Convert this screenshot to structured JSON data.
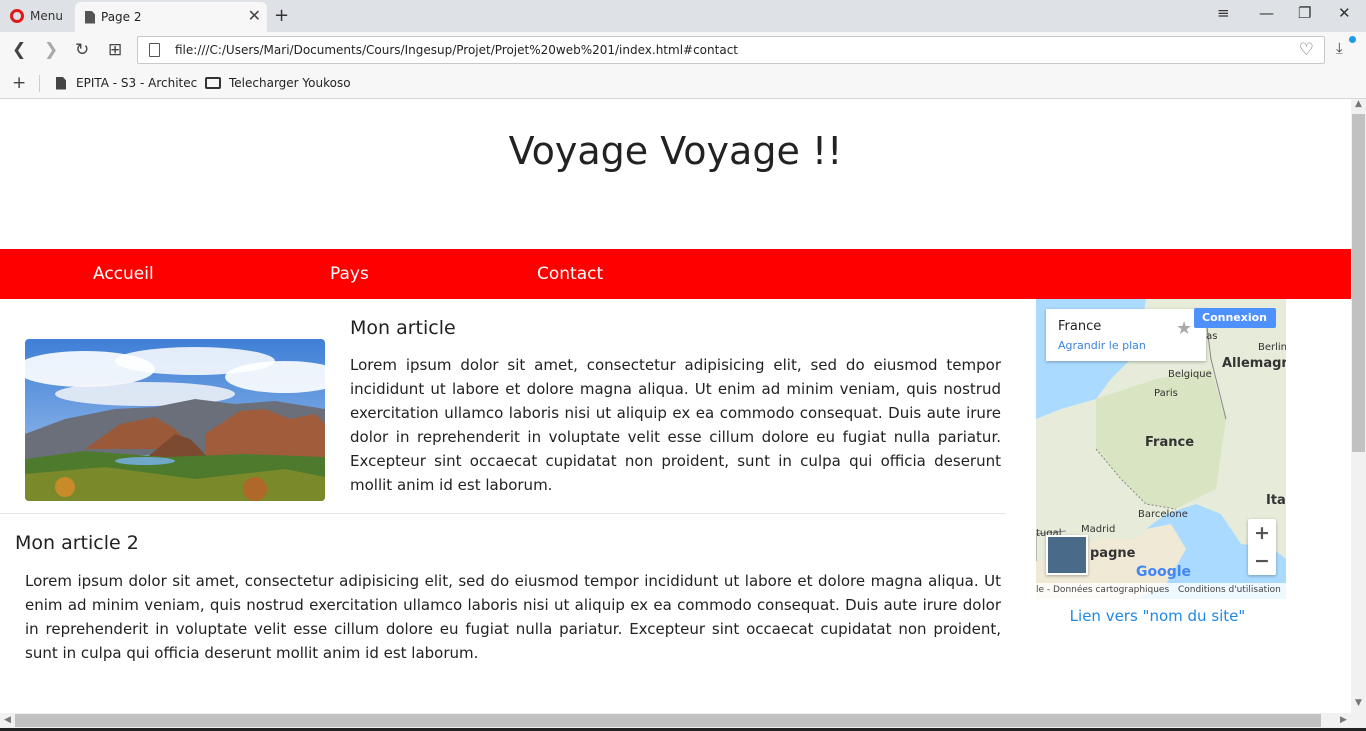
{
  "browser": {
    "menu_label": "Menu",
    "tab_title": "Page 2",
    "url": "file:///C:/Users/Mari/Documents/Cours/Ingesup/Projet/Projet%20web%201/index.html#contact",
    "bookmarks": [
      "EPITA - S3 - Architec",
      "Telecharger Youkoso"
    ]
  },
  "site": {
    "title": "Voyage Voyage !!",
    "nav": [
      "Accueil",
      "Pays",
      "Contact"
    ]
  },
  "article1": {
    "title": "Mon article",
    "text": "Lorem ipsum dolor sit amet, consectetur adipisicing elit, sed do eiusmod tempor incididunt ut labore et dolore magna aliqua. Ut enim ad minim veniam, quis nostrud exercitation ullamco laboris nisi ut aliquip ex ea commodo consequat. Duis aute irure dolor in reprehenderit in voluptate velit esse cillum dolore eu fugiat nulla pariatur. Excepteur sint occaecat cupidatat non proident, sunt in culpa qui officia deserunt mollit anim id est laborum."
  },
  "article2": {
    "title": "Mon article 2",
    "text": "Lorem ipsum dolor sit amet, consectetur adipisicing elit, sed do eiusmod tempor incididunt ut labore et dolore magna aliqua. Ut enim ad minim veniam, quis nostrud exercitation ullamco laboris nisi ut aliquip ex ea commodo consequat. Duis aute irure dolor in reprehenderit in voluptate velit esse cillum dolore eu fugiat nulla pariatur. Excepteur sint occaecat cupidatat non proident, sunt in culpa qui officia deserunt mollit anim id est laborum."
  },
  "map": {
    "place": "France",
    "enlarge": "Agrandir le plan",
    "connect": "Connexion",
    "labels": {
      "paysbas": "-Bas",
      "berlin": "Berlin",
      "allemagne": "Allemagne",
      "belgique": "Belgique",
      "paris": "Paris",
      "france": "France",
      "italie": "Itali",
      "barcelone": "Barcelone",
      "madrid": "Madrid",
      "espagne": "pagne",
      "portugal": "tugal"
    },
    "logo": "Google",
    "footer_data": "le - Données cartographiques",
    "footer_terms": "Conditions d'utilisation",
    "link": "Lien vers \"nom du site\""
  },
  "colors": {
    "nav_bg": "#ff0000",
    "link": "#1e88e5"
  }
}
